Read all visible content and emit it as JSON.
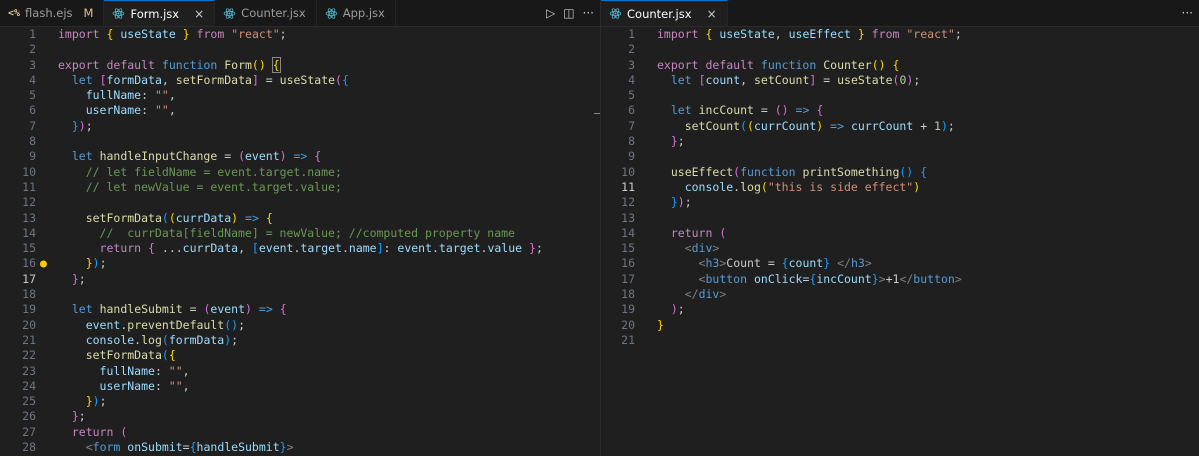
{
  "left": {
    "tabs": [
      {
        "label": "flash.ejs",
        "badge": "M",
        "icon": "ejs-icon"
      },
      {
        "label": "Form.jsx",
        "active": true,
        "icon": "react-icon",
        "close": "×"
      },
      {
        "label": "Counter.jsx",
        "icon": "react-icon"
      },
      {
        "label": "App.jsx",
        "icon": "react-icon"
      }
    ],
    "actions": {
      "run": "▷",
      "split": "◫",
      "more": "···"
    },
    "current_line": 17,
    "lines": [
      "1",
      "2",
      "3",
      "4",
      "5",
      "6",
      "7",
      "8",
      "9",
      "10",
      "11",
      "12",
      "13",
      "14",
      "15",
      "16",
      "17",
      "18",
      "19",
      "20",
      "21",
      "22",
      "23",
      "24",
      "25",
      "26",
      "27",
      "28"
    ]
  },
  "right": {
    "tabs": [
      {
        "label": "Counter.jsx",
        "active": true,
        "icon": "react-icon",
        "close": "×"
      }
    ],
    "actions": {
      "more": "···"
    },
    "current_line": 11,
    "lines": [
      "1",
      "2",
      "3",
      "4",
      "5",
      "6",
      "7",
      "8",
      "9",
      "10",
      "11",
      "12",
      "13",
      "14",
      "15",
      "16",
      "17",
      "18",
      "19",
      "20",
      "21"
    ]
  }
}
